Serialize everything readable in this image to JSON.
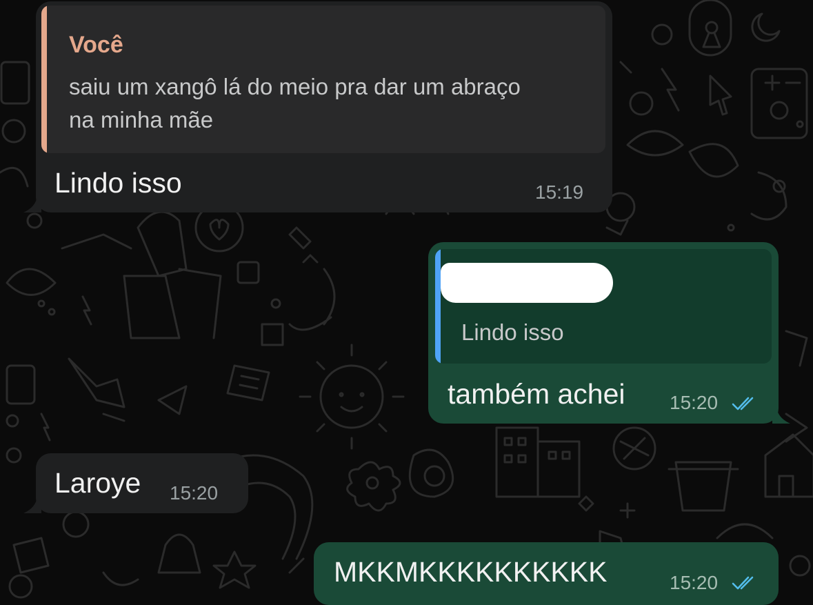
{
  "colors": {
    "background": "#0b0b0b",
    "incoming_bubble": "#1f2021",
    "outgoing_bubble": "#1a4a37",
    "quote_incoming_bg": "#29292a",
    "quote_outgoing_bg": "#123c2c",
    "quote_author_color": "#e5a88c",
    "quote_bar_incoming": "#e5a88c",
    "quote_bar_outgoing": "#4fa3f7",
    "read_ticks": "#53bdeb"
  },
  "messages": [
    {
      "direction": "incoming",
      "quote": {
        "author": "Você",
        "text_line1": "saiu um xangô lá do meio pra dar um abraço",
        "text_line2": "na minha mãe"
      },
      "text": "Lindo isso",
      "time": "15:19"
    },
    {
      "direction": "outgoing",
      "quote": {
        "author_redacted": true,
        "text": "Lindo isso"
      },
      "text": "também achei",
      "time": "15:20",
      "status_icon": "double-check-read-icon"
    },
    {
      "direction": "incoming",
      "text": "Laroye",
      "time": "15:20"
    },
    {
      "direction": "outgoing",
      "text": "MKKMKKKKKKKKKK",
      "time": "15:20",
      "status_icon": "double-check-read-icon"
    }
  ]
}
